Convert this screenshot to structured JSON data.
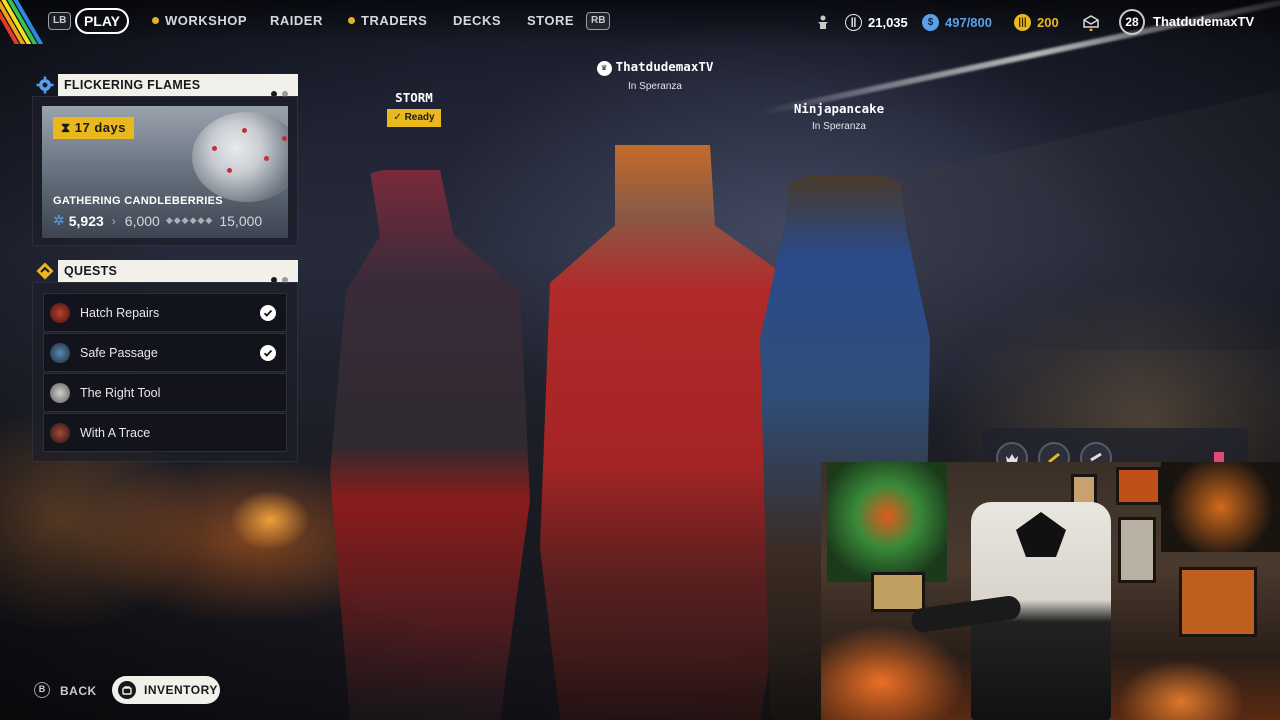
{
  "nav": {
    "lb": "LB",
    "rb": "RB",
    "play": "PLAY",
    "workshop": "WORKSHOP",
    "raider": "RAIDER",
    "traders": "TRADERS",
    "decks": "DECKS",
    "store": "STORE"
  },
  "currencies": {
    "coins": "21,035",
    "storage": "497/800",
    "tokens": "200"
  },
  "profile": {
    "level": "28",
    "username": "ThatdudemaxTV"
  },
  "event": {
    "title": "FLICKERING FLAMES",
    "days": "17 days",
    "subtitle": "GATHERING CANDLEBERRIES",
    "progress_current": "5,923",
    "progress_next": "6,000",
    "progress_max": "15,000"
  },
  "quests": {
    "title": "QUESTS",
    "items": [
      {
        "label": "Hatch Repairs",
        "done": true
      },
      {
        "label": "Safe Passage",
        "done": true
      },
      {
        "label": "The Right Tool",
        "done": false
      },
      {
        "label": "With A Trace",
        "done": false
      }
    ]
  },
  "players": {
    "storm": {
      "name": "STORM",
      "status": "Ready"
    },
    "host": {
      "name": "ThatdudemaxTV",
      "location": "In Speranza"
    },
    "ninja": {
      "name": "Ninjapancake",
      "location": "In Speranza"
    }
  },
  "bottom": {
    "b_key": "B",
    "back": "BACK",
    "inventory": "INVENTORY"
  },
  "colors": {
    "accent_yellow": "#e8b81e",
    "panel_light": "#f2f0ea",
    "currency_blue": "#5aa0e8"
  }
}
